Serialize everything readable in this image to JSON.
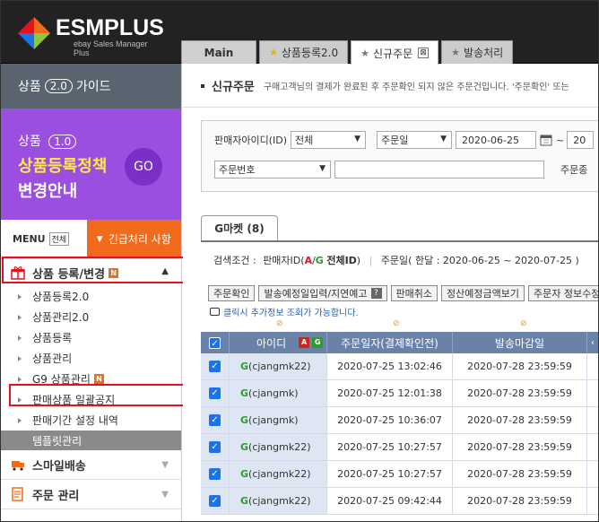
{
  "brand": {
    "name": "ESMPLUS",
    "tagline": "ebay Sales Manager Plus"
  },
  "tabs": [
    {
      "label": "Main"
    },
    {
      "label": "상품등록2.0"
    },
    {
      "label": "신규주문",
      "close": "⊠"
    },
    {
      "label": "발송처리"
    }
  ],
  "sidebar": {
    "guide": {
      "prefix": "상품",
      "version": "2.0",
      "suffix": "가이드"
    },
    "banner": {
      "line1_prefix": "상품",
      "line1_version": "1.0",
      "line2": "상품등록정책",
      "line3": "변경안내",
      "go": "GO"
    },
    "menu_label": "MENU",
    "menu_all": "전체",
    "urgent": "긴급처리 사항",
    "section": {
      "title": "상품 등록/변경",
      "badge": "N"
    },
    "items": [
      {
        "label": "상품등록2.0"
      },
      {
        "label": "상품관리2.0"
      },
      {
        "label": "상품등록"
      },
      {
        "label": "상품관리"
      },
      {
        "label": "G9 상품관리",
        "badge": "N"
      },
      {
        "label": "판매상품 일괄공지"
      },
      {
        "label": "판매기간 설정 내역"
      }
    ],
    "template": "템플릿관리",
    "groups": [
      {
        "label": "스마일배송"
      },
      {
        "label": "주문 관리"
      }
    ]
  },
  "content": {
    "title": "신규주문",
    "desc": "구매고객님의 결제가 완료된 후 주문확인 되지 않은 주문건입니다. '주문확인' 또는",
    "filter": {
      "seller_label": "판매자아이디(ID)",
      "seller_value": "전체",
      "date_type": "주문일",
      "date_from": "2020-06-25",
      "tilde": "~",
      "date_to_partial": "20",
      "search_type": "주문번호",
      "search_value": "",
      "right_label": "주문종"
    },
    "market_tab": "G마켓 (8)",
    "condition": {
      "label": "검색조건 :",
      "seller_prefix": "판매자ID(",
      "a": "A",
      "slash": "/",
      "g": "G",
      "all": "전체ID",
      "seller_suffix": ")",
      "date_text": "주문일( 한달 : 2020-06-25 ~ 2020-07-25 )"
    },
    "buttons": [
      {
        "label": "주문확인"
      },
      {
        "label": "발송예정일입력/지연예고"
      },
      {
        "label": "판매취소"
      },
      {
        "label": "정산예정금액보기"
      },
      {
        "label": "주문자 정보수정"
      }
    ],
    "hint": "클릭시 추가정보 조회가 가능합니다.",
    "grid": {
      "headers": {
        "id": "아이디",
        "a": "A",
        "g": "G",
        "order_date": "주문일자(결제확인전)",
        "deadline": "발송마감일"
      },
      "rows": [
        {
          "mark": "G",
          "id": "(cjangmk22)",
          "order_date": "2020-07-25 13:02:46",
          "deadline": "2020-07-28 23:59:59"
        },
        {
          "mark": "G",
          "id": "(cjangmk)",
          "order_date": "2020-07-25 12:01:38",
          "deadline": "2020-07-28 23:59:59"
        },
        {
          "mark": "G",
          "id": "(cjangmk)",
          "order_date": "2020-07-25 10:36:07",
          "deadline": "2020-07-28 23:59:59"
        },
        {
          "mark": "G",
          "id": "(cjangmk22)",
          "order_date": "2020-07-25 10:27:57",
          "deadline": "2020-07-28 23:59:59"
        },
        {
          "mark": "G",
          "id": "(cjangmk22)",
          "order_date": "2020-07-25 10:27:57",
          "deadline": "2020-07-28 23:59:59"
        },
        {
          "mark": "G",
          "id": "(cjangmk22)",
          "order_date": "2020-07-25 09:42:44",
          "deadline": "2020-07-28 23:59:59"
        }
      ]
    }
  },
  "colors": {
    "accent_orange": "#f26b1d",
    "banner_purple": "#9b4fe0",
    "highlight_red": "#e8101e",
    "grid_header": "#6b82a8"
  }
}
